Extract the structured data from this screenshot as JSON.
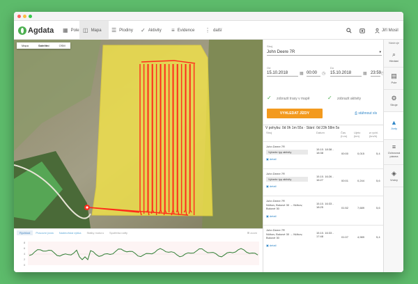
{
  "window": {
    "dots": [
      "#fc605c",
      "#fdbc40",
      "#34c84a"
    ]
  },
  "navbar": {
    "logo": "Agdata",
    "items": [
      {
        "label": "Pole",
        "icon": "field-icon"
      },
      {
        "label": "Mapa",
        "icon": "map-icon"
      },
      {
        "label": "Plodiny",
        "icon": "list-icon"
      },
      {
        "label": "Aktivity",
        "icon": "check-icon"
      },
      {
        "label": "Evidence",
        "icon": "lines-icon"
      },
      {
        "label": "další",
        "icon": "more-icon"
      }
    ],
    "user": "Jiří Mosil"
  },
  "map": {
    "tabs": [
      "Mapa",
      "Satelitní",
      "OSM"
    ],
    "active_tab": "Satelitní",
    "field_color": "#f2e24a",
    "track_color": "#ff2a1a"
  },
  "chart": {
    "tabs": [
      "Rychlost",
      "Pracovní jízda",
      "Nadmořská výška",
      "Stálky motoru",
      "Spotřeba nafty"
    ],
    "active_tab": "Rychlost",
    "zoom_label": "⊞ zoom",
    "line_color": "#2e7d32",
    "y_ticks": [
      "8",
      "6",
      "4",
      "2",
      "0"
    ]
  },
  "panel": {
    "stroj_label": "Stroj",
    "stroj_value": "John Deere 7R",
    "od_label": "Od",
    "od_date": "15.10.2018",
    "od_time": "00:00",
    "do_label": "Do",
    "do_date": "15.10.2018",
    "do_time": "23:59",
    "check1": "zobrazit trasy v mapě",
    "check2": "zobrazit aktivity",
    "search_button": "VYHLEDAT JÍZDY",
    "download": "stáhnout xls",
    "summary": "V pohybu: 0d 0h 1m 55s · Stání: 0d 23h 58m 5s",
    "columns": [
      "Stroj",
      "Datum",
      "Čas (h:m)",
      "Ujeto (km)",
      "ø rychl. (km/h)"
    ],
    "rows": [
      {
        "stroj": "John Deere 7R",
        "pill": "Vyberte typ aktivity",
        "datum": "15.10. 18:38 - 18:38",
        "cas": "00:00",
        "ujeto": "0,015",
        "rychl": "5,4",
        "detail": "detail"
      },
      {
        "stroj": "John Deere 7R",
        "pill": "Vyberte typ aktivity",
        "datum": "15.10. 16:26 - 16:27",
        "cas": "00:01",
        "ujeto": "0,244",
        "rychl": "5,6",
        "detail": "detail"
      },
      {
        "stroj": "John Deere 7R",
        "pill": "Nížkov, Bukové 30 → Nížkov, Bukové 30",
        "datum": "15.10. 16:33 - 18:25",
        "cas": "01:52",
        "ujeto": "7,689",
        "rychl": "5,6",
        "detail": "detail"
      },
      {
        "stroj": "John Deere 7R",
        "pill": "Nížkov, Bukové 30 → Nížkov, Bukové 30",
        "datum": "15.10. 16:33 - 17:48",
        "cas": "01:07",
        "ujeto": "4,989",
        "rychl": "5,4",
        "detail": "detail"
      }
    ]
  },
  "sidebar": {
    "head": "Nástroje",
    "items": [
      {
        "label": "Hledání",
        "icon": "search-icon"
      },
      {
        "label": "Pole",
        "icon": "field-icon"
      },
      {
        "label": "Stroje",
        "icon": "gear-icon"
      },
      {
        "label": "Jízdy",
        "icon": "navigate-icon"
      },
      {
        "label": "Ochranná pásma",
        "icon": "menu-icon"
      },
      {
        "label": "Vrstvy",
        "icon": "layers-icon"
      }
    ],
    "active": "Jízdy"
  }
}
